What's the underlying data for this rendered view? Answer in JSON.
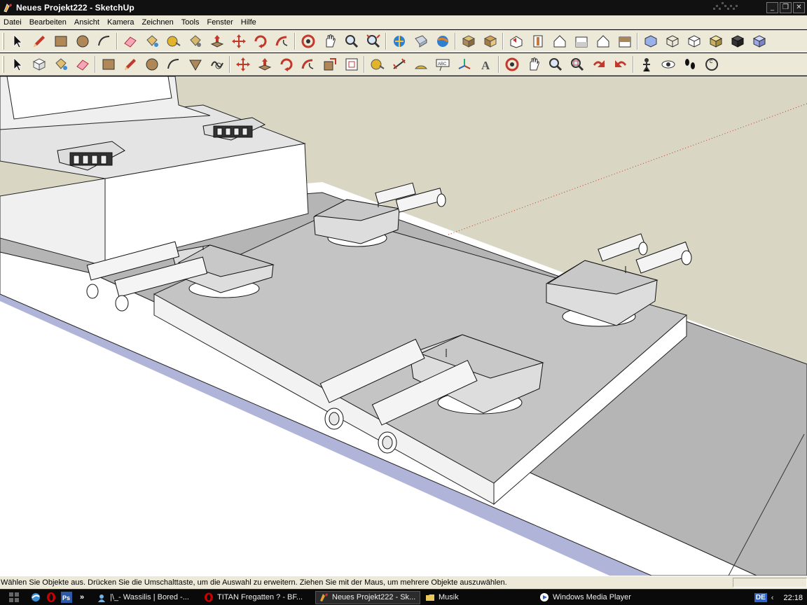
{
  "window": {
    "title": "Neues Projekt222 - SketchUp",
    "controls": {
      "minimize": "_",
      "maximize": "❐",
      "close": "✕"
    }
  },
  "menu": [
    "Datei",
    "Bearbeiten",
    "Ansicht",
    "Kamera",
    "Zeichnen",
    "Tools",
    "Fenster",
    "Hilfe"
  ],
  "toolbar_row1": [
    [
      "select-tool",
      "pencil-tool",
      "rectangle-tool",
      "circle-tool",
      "arc-tool"
    ],
    [
      "eraser-tool",
      "paint-bucket-tool",
      "tape-measure-tool",
      "paint-tool-2",
      "push-pull-tool",
      "move-tool",
      "rotate-tool",
      "follow-me-tool"
    ],
    [
      "orbit-tool",
      "pan-tool",
      "zoom-tool",
      "zoom-extents-tool"
    ],
    [
      "get-models-icon",
      "share-model-icon",
      "google-earth-icon"
    ],
    [
      "components-icon",
      "materials-icon"
    ],
    [
      "iso-view-icon",
      "top-view-icon",
      "front-view-icon",
      "right-view-icon",
      "back-view-icon",
      "left-view-icon"
    ],
    [
      "xray-style-icon",
      "wireframe-style-icon",
      "hidden-line-style-icon",
      "shaded-style-icon",
      "textured-style-icon",
      "monochrome-style-icon"
    ]
  ],
  "toolbar_row2": [
    [
      "select-tool",
      "make-component-tool",
      "paint-bucket-tool",
      "eraser-tool"
    ],
    [
      "rectangle-tool",
      "line-tool",
      "circle-tool",
      "arc-tool",
      "polygon-tool",
      "freehand-tool"
    ],
    [
      "move-tool",
      "push-pull-tool",
      "rotate-tool",
      "follow-me-tool",
      "scale-tool",
      "offset-tool"
    ],
    [
      "tape-measure-tool",
      "dimension-tool",
      "protractor-tool",
      "text-tool",
      "axes-tool",
      "3d-text-tool"
    ],
    [
      "orbit-tool",
      "pan-tool",
      "zoom-tool",
      "zoom-window-tool",
      "previous-view-tool",
      "next-view-tool"
    ],
    [
      "position-camera-tool",
      "look-around-tool",
      "walk-tool",
      "section-plane-tool"
    ]
  ],
  "toolbar_labels": {
    "text_tool": "ABC",
    "dimension_text": "A",
    "section_glyph": "C"
  },
  "status": {
    "text": "Wählen Sie Objekte aus. Drücken Sie die Umschalttaste, um die Auswahl zu erweitern. Ziehen Sie mit der Maus, um mehrere Objekte auszuwählen."
  },
  "taskbar": {
    "quick_launch": [
      "ie-icon",
      "opera-icon",
      "photoshop-icon"
    ],
    "overflow": "»",
    "tasks": [
      {
        "label": "|\\_- Wassilis  | Bored  -...",
        "icon": "messenger-icon",
        "active": false
      },
      {
        "label": "TITAN Fregatten ? - BF...",
        "icon": "opera-icon",
        "active": false
      },
      {
        "label": "Neues Projekt222 - Sk...",
        "icon": "sketchup-icon",
        "active": true
      },
      {
        "label": "Musik",
        "icon": "folder-icon",
        "active": false
      },
      {
        "label": "Windows Media Player",
        "icon": "media-player-icon",
        "active": false
      }
    ],
    "language": "DE",
    "tray_arrow": "‹",
    "clock": "22:18"
  },
  "colors": {
    "sky": "#d9d6c3",
    "ground_top": "#ffffff",
    "water": "#b0b4d8",
    "hull_top": "#b5b5b5",
    "deck": "#c4c4c4",
    "ui_face": "#ece9d8",
    "taskbar": "#0a0a0a",
    "axis_red": "#c0392b"
  }
}
